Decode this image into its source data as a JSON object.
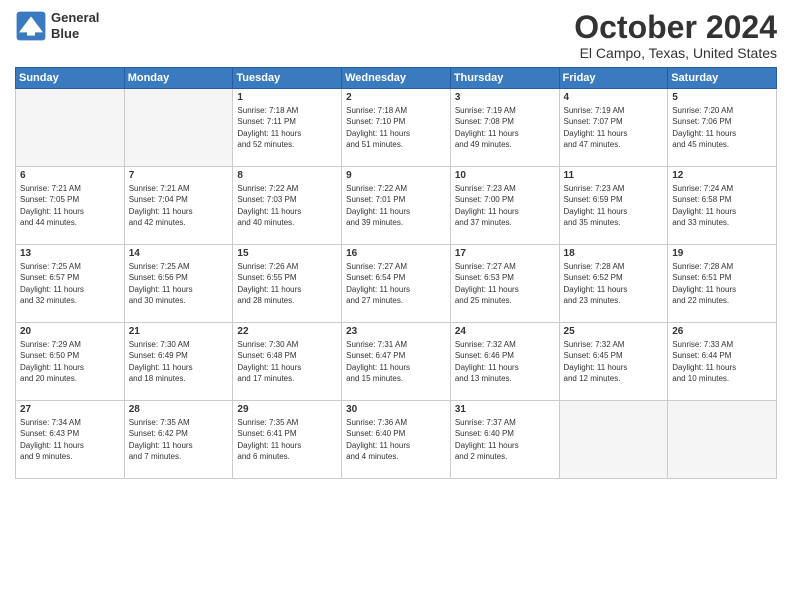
{
  "logo": {
    "line1": "General",
    "line2": "Blue"
  },
  "title": "October 2024",
  "location": "El Campo, Texas, United States",
  "header": {
    "cols": [
      "Sunday",
      "Monday",
      "Tuesday",
      "Wednesday",
      "Thursday",
      "Friday",
      "Saturday"
    ]
  },
  "days": [
    {
      "num": "",
      "info": ""
    },
    {
      "num": "",
      "info": ""
    },
    {
      "num": "1",
      "info": "Sunrise: 7:18 AM\nSunset: 7:11 PM\nDaylight: 11 hours\nand 52 minutes."
    },
    {
      "num": "2",
      "info": "Sunrise: 7:18 AM\nSunset: 7:10 PM\nDaylight: 11 hours\nand 51 minutes."
    },
    {
      "num": "3",
      "info": "Sunrise: 7:19 AM\nSunset: 7:08 PM\nDaylight: 11 hours\nand 49 minutes."
    },
    {
      "num": "4",
      "info": "Sunrise: 7:19 AM\nSunset: 7:07 PM\nDaylight: 11 hours\nand 47 minutes."
    },
    {
      "num": "5",
      "info": "Sunrise: 7:20 AM\nSunset: 7:06 PM\nDaylight: 11 hours\nand 45 minutes."
    },
    {
      "num": "6",
      "info": "Sunrise: 7:21 AM\nSunset: 7:05 PM\nDaylight: 11 hours\nand 44 minutes."
    },
    {
      "num": "7",
      "info": "Sunrise: 7:21 AM\nSunset: 7:04 PM\nDaylight: 11 hours\nand 42 minutes."
    },
    {
      "num": "8",
      "info": "Sunrise: 7:22 AM\nSunset: 7:03 PM\nDaylight: 11 hours\nand 40 minutes."
    },
    {
      "num": "9",
      "info": "Sunrise: 7:22 AM\nSunset: 7:01 PM\nDaylight: 11 hours\nand 39 minutes."
    },
    {
      "num": "10",
      "info": "Sunrise: 7:23 AM\nSunset: 7:00 PM\nDaylight: 11 hours\nand 37 minutes."
    },
    {
      "num": "11",
      "info": "Sunrise: 7:23 AM\nSunset: 6:59 PM\nDaylight: 11 hours\nand 35 minutes."
    },
    {
      "num": "12",
      "info": "Sunrise: 7:24 AM\nSunset: 6:58 PM\nDaylight: 11 hours\nand 33 minutes."
    },
    {
      "num": "13",
      "info": "Sunrise: 7:25 AM\nSunset: 6:57 PM\nDaylight: 11 hours\nand 32 minutes."
    },
    {
      "num": "14",
      "info": "Sunrise: 7:25 AM\nSunset: 6:56 PM\nDaylight: 11 hours\nand 30 minutes."
    },
    {
      "num": "15",
      "info": "Sunrise: 7:26 AM\nSunset: 6:55 PM\nDaylight: 11 hours\nand 28 minutes."
    },
    {
      "num": "16",
      "info": "Sunrise: 7:27 AM\nSunset: 6:54 PM\nDaylight: 11 hours\nand 27 minutes."
    },
    {
      "num": "17",
      "info": "Sunrise: 7:27 AM\nSunset: 6:53 PM\nDaylight: 11 hours\nand 25 minutes."
    },
    {
      "num": "18",
      "info": "Sunrise: 7:28 AM\nSunset: 6:52 PM\nDaylight: 11 hours\nand 23 minutes."
    },
    {
      "num": "19",
      "info": "Sunrise: 7:28 AM\nSunset: 6:51 PM\nDaylight: 11 hours\nand 22 minutes."
    },
    {
      "num": "20",
      "info": "Sunrise: 7:29 AM\nSunset: 6:50 PM\nDaylight: 11 hours\nand 20 minutes."
    },
    {
      "num": "21",
      "info": "Sunrise: 7:30 AM\nSunset: 6:49 PM\nDaylight: 11 hours\nand 18 minutes."
    },
    {
      "num": "22",
      "info": "Sunrise: 7:30 AM\nSunset: 6:48 PM\nDaylight: 11 hours\nand 17 minutes."
    },
    {
      "num": "23",
      "info": "Sunrise: 7:31 AM\nSunset: 6:47 PM\nDaylight: 11 hours\nand 15 minutes."
    },
    {
      "num": "24",
      "info": "Sunrise: 7:32 AM\nSunset: 6:46 PM\nDaylight: 11 hours\nand 13 minutes."
    },
    {
      "num": "25",
      "info": "Sunrise: 7:32 AM\nSunset: 6:45 PM\nDaylight: 11 hours\nand 12 minutes."
    },
    {
      "num": "26",
      "info": "Sunrise: 7:33 AM\nSunset: 6:44 PM\nDaylight: 11 hours\nand 10 minutes."
    },
    {
      "num": "27",
      "info": "Sunrise: 7:34 AM\nSunset: 6:43 PM\nDaylight: 11 hours\nand 9 minutes."
    },
    {
      "num": "28",
      "info": "Sunrise: 7:35 AM\nSunset: 6:42 PM\nDaylight: 11 hours\nand 7 minutes."
    },
    {
      "num": "29",
      "info": "Sunrise: 7:35 AM\nSunset: 6:41 PM\nDaylight: 11 hours\nand 6 minutes."
    },
    {
      "num": "30",
      "info": "Sunrise: 7:36 AM\nSunset: 6:40 PM\nDaylight: 11 hours\nand 4 minutes."
    },
    {
      "num": "31",
      "info": "Sunrise: 7:37 AM\nSunset: 6:40 PM\nDaylight: 11 hours\nand 2 minutes."
    },
    {
      "num": "",
      "info": ""
    },
    {
      "num": "",
      "info": ""
    }
  ]
}
